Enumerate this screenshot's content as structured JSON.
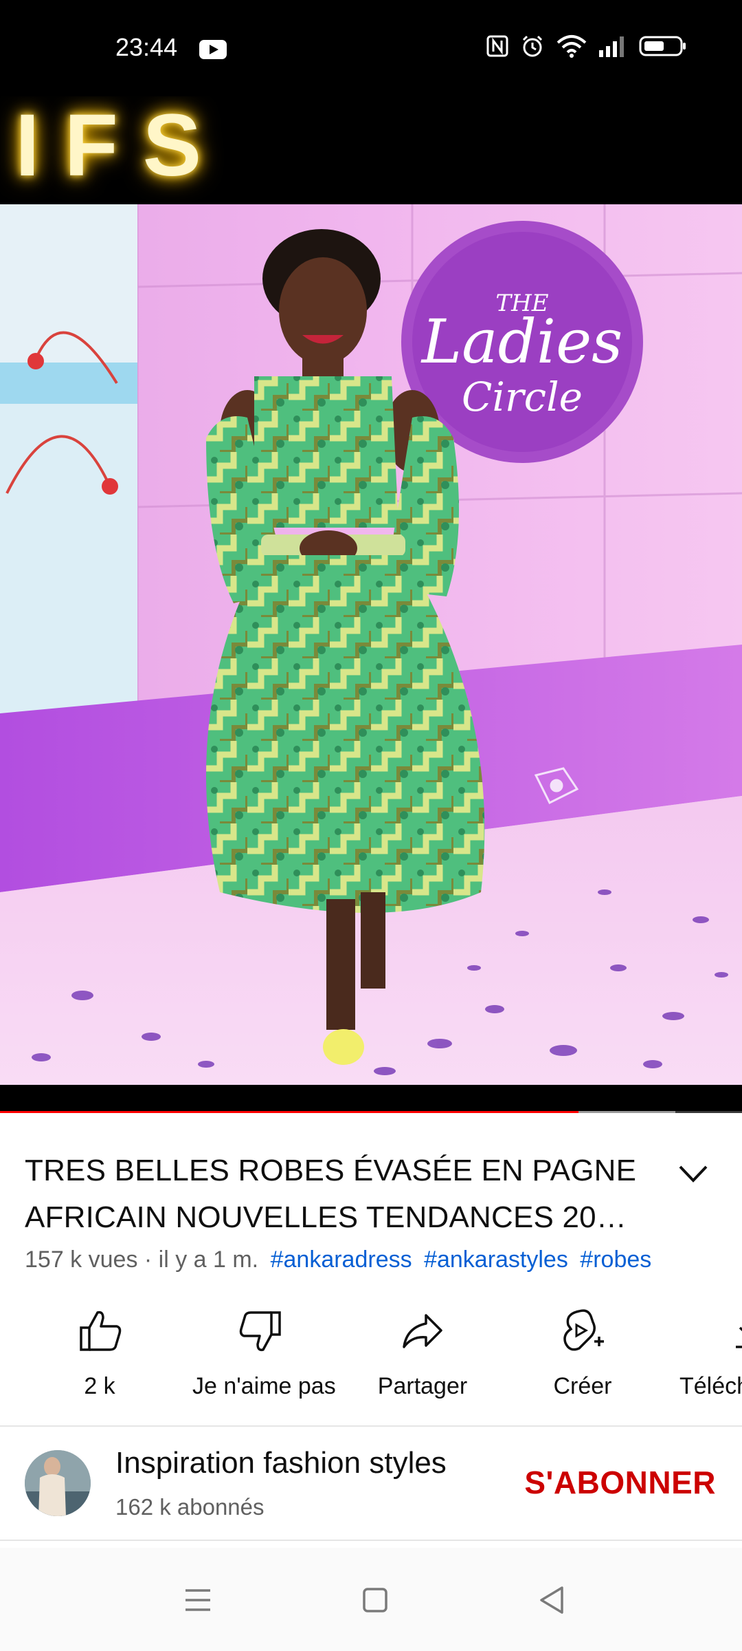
{
  "status_bar": {
    "time": "23:44",
    "icons": [
      "youtube-notification-icon",
      "nfc-icon",
      "alarm-icon",
      "wifi-icon",
      "signal-icon",
      "battery-icon"
    ]
  },
  "video": {
    "overlay_text": "IFS",
    "set_sign_text_1": "THE",
    "set_sign_text_2": "Ladies",
    "set_sign_text_3": "Circle",
    "progress_fraction": 0.78,
    "buffered_fraction": 0.91
  },
  "info": {
    "title": "TRES BELLES ROBES ÉVASÉE EN PAGNE AFRICAIN NOUVELLES TENDANCES 20…",
    "views_and_date": "157 k vues · il y a 1 m.",
    "hashtags": [
      "#ankaradress",
      "#ankarastyles",
      "#robes"
    ]
  },
  "actions": {
    "like": "2 k",
    "dislike": "Je n'aime pas",
    "share": "Partager",
    "create": "Créer",
    "download": "Téléch"
  },
  "channel": {
    "name": "Inspiration fashion styles",
    "subscribers": "162 k abonnés",
    "subscribe_label": "S'ABONNER"
  },
  "colors": {
    "accent_red": "#cc0000",
    "progress_red": "#ff0000",
    "hashtag_blue": "#065fd4"
  }
}
